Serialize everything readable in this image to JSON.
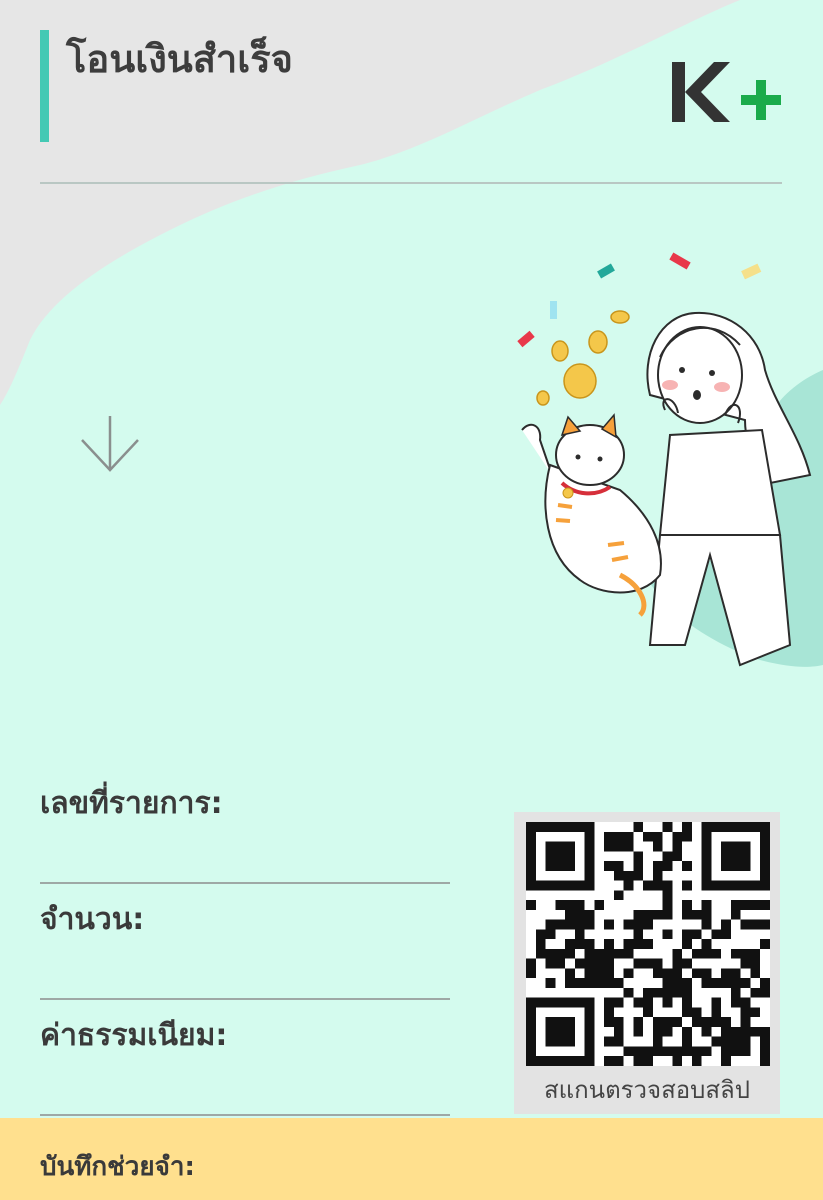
{
  "header": {
    "title": "โอนเงินสำเร็จ",
    "logo_text": "K+",
    "colors": {
      "accent_bar": "#44c9b4",
      "logo_dark": "#333333",
      "logo_green": "#1aab4b"
    }
  },
  "transfer": {
    "direction_icon": "arrow-down-icon"
  },
  "details": {
    "reference_label": "เลขที่รายการ:",
    "amount_label": "จำนวน:",
    "fee_label": "ค่าธรรมเนียม:"
  },
  "qr": {
    "caption": "สแกนตรวจสอบสลิป",
    "icon": "qr-code-icon"
  },
  "memo": {
    "label": "บันทึกช่วยจำ:"
  },
  "illustration": {
    "icon": "celebration-illustration",
    "colors": {
      "background": "#d4fbee",
      "wave": "#e6e6e6",
      "blob": "#a8e5d6",
      "coin": "#f4c74a"
    }
  }
}
